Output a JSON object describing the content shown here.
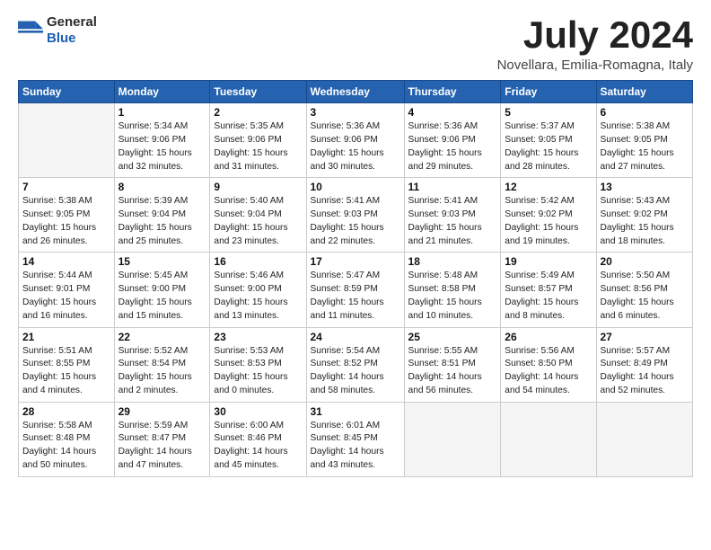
{
  "header": {
    "logo_line1": "General",
    "logo_line2": "Blue",
    "month_title": "July 2024",
    "location": "Novellara, Emilia-Romagna, Italy"
  },
  "weekdays": [
    "Sunday",
    "Monday",
    "Tuesday",
    "Wednesday",
    "Thursday",
    "Friday",
    "Saturday"
  ],
  "weeks": [
    [
      {
        "day": "",
        "info": ""
      },
      {
        "day": "1",
        "info": "Sunrise: 5:34 AM\nSunset: 9:06 PM\nDaylight: 15 hours\nand 32 minutes."
      },
      {
        "day": "2",
        "info": "Sunrise: 5:35 AM\nSunset: 9:06 PM\nDaylight: 15 hours\nand 31 minutes."
      },
      {
        "day": "3",
        "info": "Sunrise: 5:36 AM\nSunset: 9:06 PM\nDaylight: 15 hours\nand 30 minutes."
      },
      {
        "day": "4",
        "info": "Sunrise: 5:36 AM\nSunset: 9:06 PM\nDaylight: 15 hours\nand 29 minutes."
      },
      {
        "day": "5",
        "info": "Sunrise: 5:37 AM\nSunset: 9:05 PM\nDaylight: 15 hours\nand 28 minutes."
      },
      {
        "day": "6",
        "info": "Sunrise: 5:38 AM\nSunset: 9:05 PM\nDaylight: 15 hours\nand 27 minutes."
      }
    ],
    [
      {
        "day": "7",
        "info": "Sunrise: 5:38 AM\nSunset: 9:05 PM\nDaylight: 15 hours\nand 26 minutes."
      },
      {
        "day": "8",
        "info": "Sunrise: 5:39 AM\nSunset: 9:04 PM\nDaylight: 15 hours\nand 25 minutes."
      },
      {
        "day": "9",
        "info": "Sunrise: 5:40 AM\nSunset: 9:04 PM\nDaylight: 15 hours\nand 23 minutes."
      },
      {
        "day": "10",
        "info": "Sunrise: 5:41 AM\nSunset: 9:03 PM\nDaylight: 15 hours\nand 22 minutes."
      },
      {
        "day": "11",
        "info": "Sunrise: 5:41 AM\nSunset: 9:03 PM\nDaylight: 15 hours\nand 21 minutes."
      },
      {
        "day": "12",
        "info": "Sunrise: 5:42 AM\nSunset: 9:02 PM\nDaylight: 15 hours\nand 19 minutes."
      },
      {
        "day": "13",
        "info": "Sunrise: 5:43 AM\nSunset: 9:02 PM\nDaylight: 15 hours\nand 18 minutes."
      }
    ],
    [
      {
        "day": "14",
        "info": "Sunrise: 5:44 AM\nSunset: 9:01 PM\nDaylight: 15 hours\nand 16 minutes."
      },
      {
        "day": "15",
        "info": "Sunrise: 5:45 AM\nSunset: 9:00 PM\nDaylight: 15 hours\nand 15 minutes."
      },
      {
        "day": "16",
        "info": "Sunrise: 5:46 AM\nSunset: 9:00 PM\nDaylight: 15 hours\nand 13 minutes."
      },
      {
        "day": "17",
        "info": "Sunrise: 5:47 AM\nSunset: 8:59 PM\nDaylight: 15 hours\nand 11 minutes."
      },
      {
        "day": "18",
        "info": "Sunrise: 5:48 AM\nSunset: 8:58 PM\nDaylight: 15 hours\nand 10 minutes."
      },
      {
        "day": "19",
        "info": "Sunrise: 5:49 AM\nSunset: 8:57 PM\nDaylight: 15 hours\nand 8 minutes."
      },
      {
        "day": "20",
        "info": "Sunrise: 5:50 AM\nSunset: 8:56 PM\nDaylight: 15 hours\nand 6 minutes."
      }
    ],
    [
      {
        "day": "21",
        "info": "Sunrise: 5:51 AM\nSunset: 8:55 PM\nDaylight: 15 hours\nand 4 minutes."
      },
      {
        "day": "22",
        "info": "Sunrise: 5:52 AM\nSunset: 8:54 PM\nDaylight: 15 hours\nand 2 minutes."
      },
      {
        "day": "23",
        "info": "Sunrise: 5:53 AM\nSunset: 8:53 PM\nDaylight: 15 hours\nand 0 minutes."
      },
      {
        "day": "24",
        "info": "Sunrise: 5:54 AM\nSunset: 8:52 PM\nDaylight: 14 hours\nand 58 minutes."
      },
      {
        "day": "25",
        "info": "Sunrise: 5:55 AM\nSunset: 8:51 PM\nDaylight: 14 hours\nand 56 minutes."
      },
      {
        "day": "26",
        "info": "Sunrise: 5:56 AM\nSunset: 8:50 PM\nDaylight: 14 hours\nand 54 minutes."
      },
      {
        "day": "27",
        "info": "Sunrise: 5:57 AM\nSunset: 8:49 PM\nDaylight: 14 hours\nand 52 minutes."
      }
    ],
    [
      {
        "day": "28",
        "info": "Sunrise: 5:58 AM\nSunset: 8:48 PM\nDaylight: 14 hours\nand 50 minutes."
      },
      {
        "day": "29",
        "info": "Sunrise: 5:59 AM\nSunset: 8:47 PM\nDaylight: 14 hours\nand 47 minutes."
      },
      {
        "day": "30",
        "info": "Sunrise: 6:00 AM\nSunset: 8:46 PM\nDaylight: 14 hours\nand 45 minutes."
      },
      {
        "day": "31",
        "info": "Sunrise: 6:01 AM\nSunset: 8:45 PM\nDaylight: 14 hours\nand 43 minutes."
      },
      {
        "day": "",
        "info": ""
      },
      {
        "day": "",
        "info": ""
      },
      {
        "day": "",
        "info": ""
      }
    ]
  ]
}
